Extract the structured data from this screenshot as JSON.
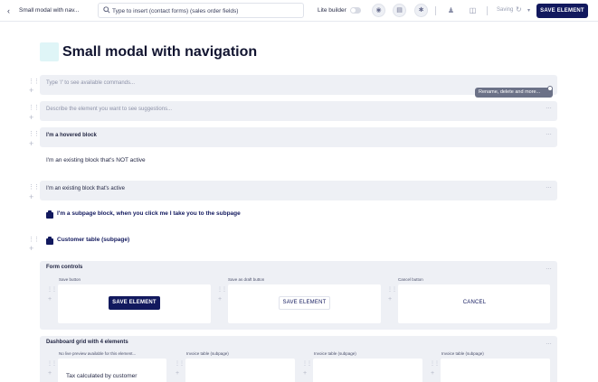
{
  "topbar": {
    "back_icon": "chevron-left-icon",
    "doc_title": "Small modal with nav...",
    "search_placeholder": "Type to insert (contact forms) (sales order fields)",
    "lite_builder_label": "Lite builder",
    "saving_label": "Saving",
    "save_button": "SAVE ELEMENT"
  },
  "page": {
    "title": "Small modal with navigation"
  },
  "blocks": {
    "command_placeholder": "Type '/' to see available commands...",
    "describe_placeholder": "Describe the element you want to see suggestions...",
    "hovered_title": "I'm a hovered block",
    "not_active_text": "I'm an existing block that's NOT active",
    "active_title": "I'm an existing block that's active",
    "subpage_link": "I'm a subpage block, when you click me I take you to the subpage",
    "customer_table": "Customer table (subpage)",
    "more_icon": "ellipsis-icon"
  },
  "tooltip": {
    "text": "Rename, delete and more..."
  },
  "form_controls": {
    "title": "Form controls",
    "cells": [
      {
        "label": "Save button",
        "button": "SAVE ELEMENT"
      },
      {
        "label": "Save as draft button",
        "button": "SAVE ELEMENT"
      },
      {
        "label": "Cancel button",
        "button": "CANCEL"
      }
    ]
  },
  "dashboard": {
    "title": "Dashboard grid with 4 elements",
    "cells": [
      {
        "label": "No live preview available for this element...",
        "content": "Tax calculated by customer"
      },
      {
        "label": "Invoice table (subpage)"
      },
      {
        "label": "Invoice table (subpage)"
      },
      {
        "label": "Invoice table (subpage)"
      }
    ]
  },
  "colors": {
    "primary": "#12195e",
    "block_bg": "#eef0f5",
    "tooltip_bg": "#6b7187"
  }
}
